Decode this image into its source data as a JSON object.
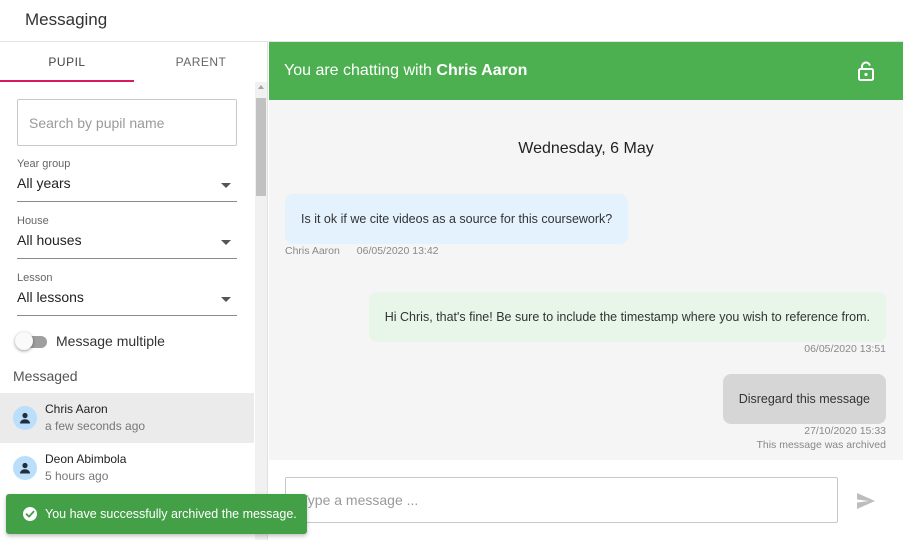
{
  "app": {
    "title": "Messaging"
  },
  "tabs": [
    {
      "label": "PUPIL",
      "active": true
    },
    {
      "label": "PARENT",
      "active": false
    }
  ],
  "search": {
    "placeholder": "Search by pupil name",
    "value": ""
  },
  "filters": [
    {
      "label": "Year group",
      "value": "All years"
    },
    {
      "label": "House",
      "value": "All houses"
    },
    {
      "label": "Lesson",
      "value": "All lessons"
    }
  ],
  "toggle": {
    "label": "Message multiple",
    "on": false
  },
  "messaged": {
    "label": "Messaged",
    "contacts": [
      {
        "name": "Chris Aaron",
        "time": "a few seconds ago",
        "selected": true
      },
      {
        "name": "Deon Abimbola",
        "time": "5 hours ago",
        "selected": false
      }
    ]
  },
  "chat": {
    "header_prefix": "You are chatting with",
    "header_name": "Chris Aaron",
    "date": "Wednesday, 6 May",
    "messages": [
      {
        "direction": "in",
        "text": "Is it ok if we cite videos as a source for this coursework?",
        "sender": "Chris Aaron",
        "timestamp": "06/05/2020 13:42"
      },
      {
        "direction": "out",
        "text": "Hi Chris, that's fine! Be sure to include the timestamp where you wish to reference from.",
        "timestamp": "06/05/2020 13:51"
      },
      {
        "direction": "out",
        "text": "Disregard this message",
        "timestamp": "27/10/2020 15:33",
        "note": "This message was archived"
      }
    ]
  },
  "composer": {
    "placeholder": "Type a message ...",
    "value": ""
  },
  "toast": {
    "message": "You have successfully archived the message."
  },
  "colors": {
    "header": "#4caf50",
    "tab_underline": "#d81b60",
    "toast": "#43a047",
    "incoming_bubble": "#e3f2fd",
    "outgoing_bubble": "#e8f5e9",
    "archived_bubble": "#d6d6d6"
  },
  "icons": {
    "lock": "lock-open-icon",
    "send": "send-icon",
    "avatar": "person-icon",
    "toast": "check-circle-icon"
  }
}
